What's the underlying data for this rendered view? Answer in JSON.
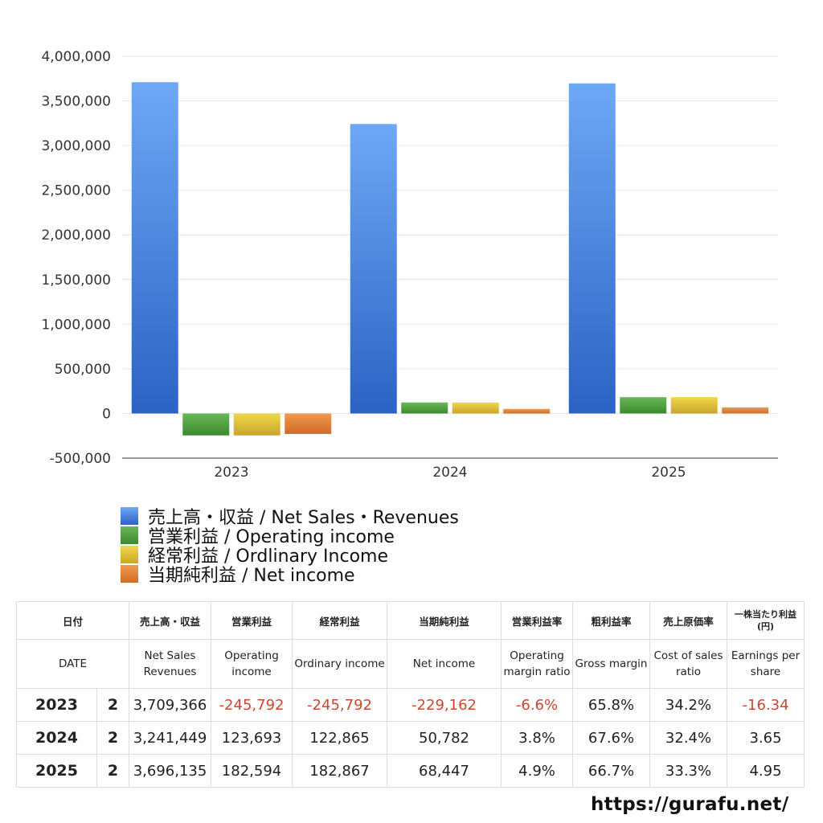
{
  "chart_data": {
    "type": "bar",
    "categories": [
      "2023",
      "2024",
      "2025"
    ],
    "series": [
      {
        "name": "売上高・収益 / Net Sales・Revenues",
        "values": [
          3709366,
          3241449,
          3696135
        ],
        "color": "#4a86e0"
      },
      {
        "name": "営業利益 / Operating income",
        "values": [
          -245792,
          123693,
          182594
        ],
        "color": "#4f9e3a"
      },
      {
        "name": "経常利益 / Ordlinary Income",
        "values": [
          -245792,
          122865,
          182867
        ],
        "color": "#d8b834"
      },
      {
        "name": "当期純利益 / Net income",
        "values": [
          -229162,
          50782,
          68447
        ],
        "color": "#e07d35"
      }
    ],
    "ylim": [
      -500000,
      4000000
    ],
    "yticks": [
      "-500,000",
      "0",
      "500,000",
      "1,000,000",
      "1,500,000",
      "2,000,000",
      "2,500,000",
      "3,000,000",
      "3,500,000",
      "4,000,000"
    ],
    "grid": true,
    "legend": "bottom"
  },
  "table": {
    "header_jp": [
      "日付",
      "売上高・収益",
      "営業利益",
      "経常利益",
      "当期純利益",
      "営業利益率",
      "粗利益率",
      "売上原価率",
      "一株当たり利益(円)"
    ],
    "header_en": [
      "DATE",
      "Net Sales Revenues",
      "Operating income",
      "Ordinary income",
      "Net income",
      "Operating margin ratio",
      "Gross margin",
      "Cost of sales ratio",
      "Earnings per share"
    ],
    "rows": [
      {
        "year": "2023",
        "months": "2",
        "sales": "3,709,366",
        "op": "-245,792",
        "ord": "-245,792",
        "net": "-229,162",
        "opm": "-6.6%",
        "gm": "65.8%",
        "cost": "34.2%",
        "eps": "-16.34"
      },
      {
        "year": "2024",
        "months": "2",
        "sales": "3,241,449",
        "op": "123,693",
        "ord": "122,865",
        "net": "50,782",
        "opm": "3.8%",
        "gm": "67.6%",
        "cost": "32.4%",
        "eps": "3.65"
      },
      {
        "year": "2025",
        "months": "2",
        "sales": "3,696,135",
        "op": "182,594",
        "ord": "182,867",
        "net": "68,447",
        "opm": "4.9%",
        "gm": "66.7%",
        "cost": "33.3%",
        "eps": "4.95"
      }
    ]
  },
  "site": "https://gurafu.net/"
}
